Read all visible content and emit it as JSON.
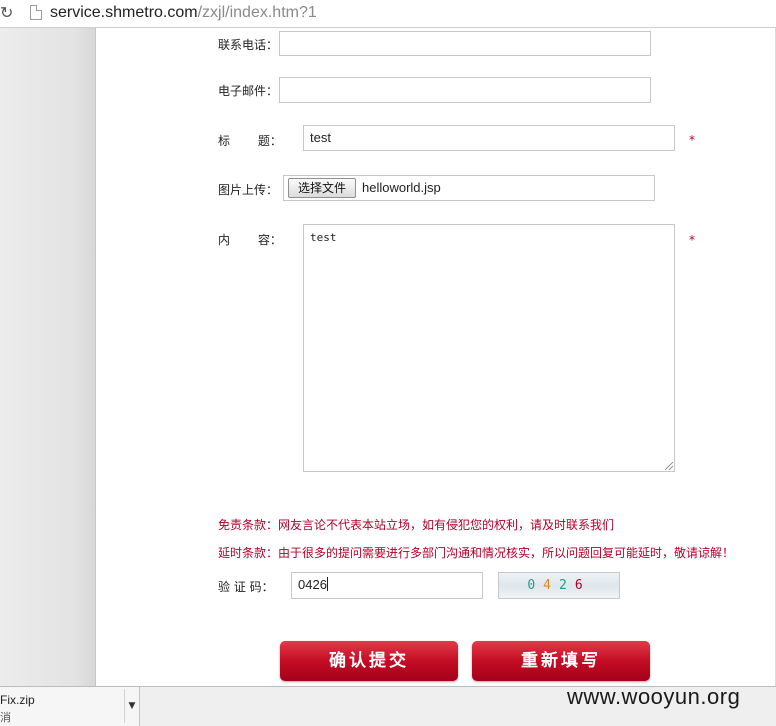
{
  "browser": {
    "url_host": "service.shmetro.com",
    "url_path": "/zxjl/index.htm?1"
  },
  "form": {
    "phone_label": "联系电话：",
    "email_label": "电子邮件：",
    "title_label": "标　　 题：",
    "title_value": "test",
    "image_label": "图片上传：",
    "file_button": "选择文件",
    "file_name": "helloworld.jsp",
    "content_label": "内　　 容：",
    "content_value": "test",
    "required_mark": "*",
    "disclaimer": "免责条款：网友言论不代表本站立场，如有侵犯您的权利，请及时联系我们",
    "delay_notice": "延时条款：由于很多的提问需要进行多部门沟通和情况核实，所以问题回复可能延时，敬请谅解！",
    "captcha_label": "验 证 码：",
    "captcha_value": "0426",
    "captcha_digits": [
      "0",
      "4",
      "2",
      "6"
    ],
    "submit_label": "确认提交",
    "reset_label": "重新填写"
  },
  "download_bar": {
    "file": "Fix.zip",
    "status": "消"
  },
  "watermark": "www.wooyun.org",
  "colors": {
    "accent": "#b4002a",
    "button": "#c40d24"
  },
  "icons": {
    "reload": "reload-icon",
    "page": "page-icon",
    "dropdown": "chevron-down-icon"
  }
}
